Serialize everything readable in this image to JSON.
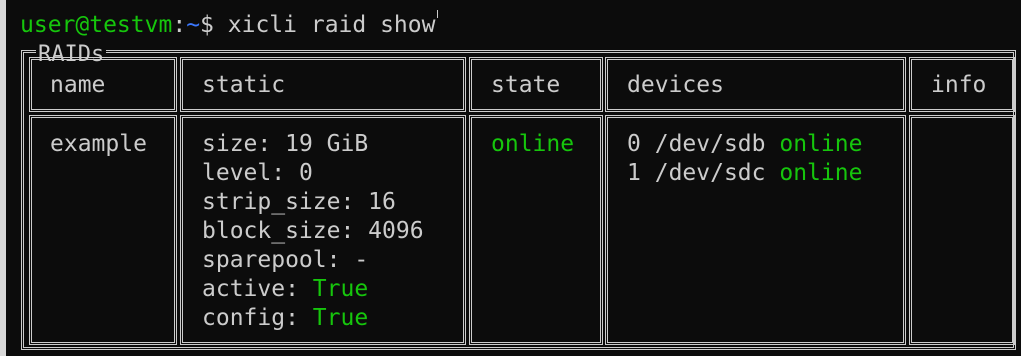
{
  "prompt": {
    "user_host": "user@testvm",
    "separator": ":",
    "path": "~",
    "symbol": "$",
    "command": "xicli raid show"
  },
  "box_title": "RAIDs",
  "headers": [
    "name",
    "static",
    "state",
    "devices",
    "info"
  ],
  "row": {
    "name": "example",
    "static": [
      {
        "key": "size: ",
        "value": "19 GiB",
        "highlight": false
      },
      {
        "key": "level: ",
        "value": "0",
        "highlight": false
      },
      {
        "key": "strip_size: ",
        "value": "16",
        "highlight": false
      },
      {
        "key": "block_size: ",
        "value": "4096",
        "highlight": false
      },
      {
        "key": "sparepool: ",
        "value": "-",
        "highlight": false
      },
      {
        "key": "active: ",
        "value": "True",
        "highlight": true
      },
      {
        "key": "config: ",
        "value": "True",
        "highlight": true
      }
    ],
    "state": "online",
    "devices": [
      {
        "index": "0",
        "path": "/dev/sdb",
        "status": "online"
      },
      {
        "index": "1",
        "path": "/dev/sdc",
        "status": "online"
      }
    ],
    "info": ""
  },
  "colors": {
    "background": "#0c0c0c",
    "text": "#cccccc",
    "green": "#16c60c",
    "blue": "#3b78ff"
  }
}
